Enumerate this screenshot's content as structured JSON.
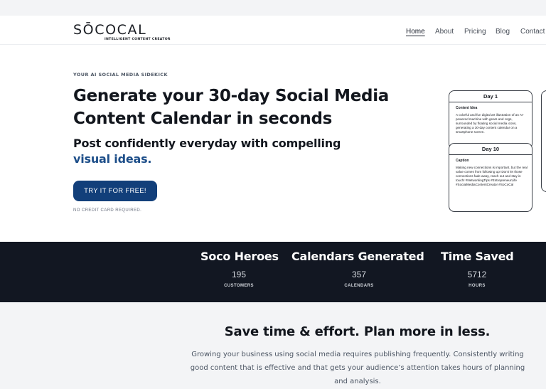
{
  "brand": {
    "name": "SŌCOCAL",
    "tagline": "INTELLIGENT CONTENT CREATOR"
  },
  "nav": {
    "items": [
      "Home",
      "About",
      "Pricing",
      "Blog",
      "Contact"
    ],
    "active": "Home"
  },
  "hero": {
    "eyebrow": "YOUR AI SOCIAL MEDIA SIDEKICK",
    "title": "Generate your 30-day Social Media Content Calendar in seconds",
    "subtitle": "Post confidently everyday with compelling",
    "subtitle_accent": "visual ideas.",
    "cta_label": "TRY IT FOR FREE!",
    "note": "NO CREDIT CARD REQUIRED."
  },
  "cards": [
    {
      "title": "Day 1",
      "label": "Content Idea",
      "body": "A colorful and fun digital art illustration of an AI-powered machine with gears and cogs, surrounded by floating social media icons, generating a 30-day content calendar on a smartphone screen."
    },
    {
      "title": "Day 10",
      "label": "Caption",
      "body": "Making new connections is important, but the real value comes from following up! Don't let those connections fade away, reach out and stay in touch! #NetworkingTips #EntrepreneurLife #SocialMediaContentCreator #SoCoCal"
    }
  ],
  "stats": [
    {
      "title": "Soco Heroes",
      "value": "195",
      "label": "CUSTOMERS"
    },
    {
      "title": "Calendars Generated",
      "value": "357",
      "label": "CALENDARS"
    },
    {
      "title": "Time Saved",
      "value": "5712",
      "label": "HOURS"
    }
  ],
  "section": {
    "title": "Save time & effort. Plan more in less.",
    "body": "Growing your business using social media requires publishing frequently. Consistently writing good content that is effective and that gets your audience’s attention takes hours of planning and analysis."
  },
  "colors": {
    "accent": "#1d4e89",
    "button": "#123f7a",
    "dark_band": "#121722",
    "light_band": "#f3f4f6"
  }
}
